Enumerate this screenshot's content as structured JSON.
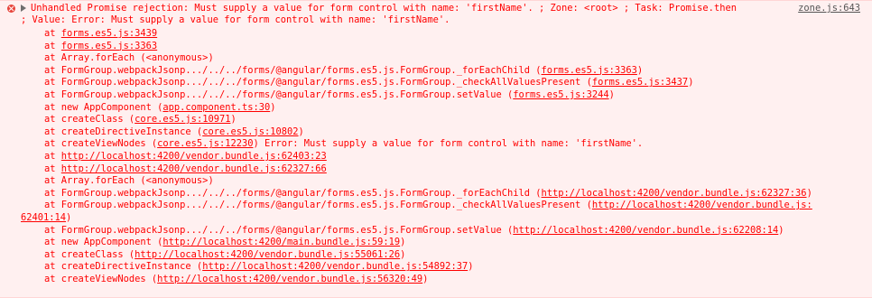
{
  "colors": {
    "background": "#fff0f0",
    "error_text": "#ff0000",
    "source_link": "#555555"
  },
  "icons": [
    "error-icon",
    "expand-triangle-icon"
  ],
  "message": {
    "line1": "Unhandled Promise rejection: Must supply a value for form control with name: 'firstName'. ; Zone: <root> ; Task: Promise.then",
    "line2": "; Value: Error: Must supply a value for form control with name: 'firstName'.",
    "source": "zone.js:643"
  },
  "stack": [
    {
      "pre": "    at ",
      "link": "forms.es5.js:3439",
      "post": ""
    },
    {
      "pre": "    at ",
      "link": "forms.es5.js:3363",
      "post": ""
    },
    {
      "pre": "    at Array.forEach (<anonymous>)",
      "link": "",
      "post": ""
    },
    {
      "pre": "    at FormGroup.webpackJsonp.../../../forms/@angular/forms.es5.js.FormGroup._forEachChild (",
      "link": "forms.es5.js:3363",
      "post": ")"
    },
    {
      "pre": "    at FormGroup.webpackJsonp.../../../forms/@angular/forms.es5.js.FormGroup._checkAllValuesPresent (",
      "link": "forms.es5.js:3437",
      "post": ")"
    },
    {
      "pre": "    at FormGroup.webpackJsonp.../../../forms/@angular/forms.es5.js.FormGroup.setValue (",
      "link": "forms.es5.js:3244",
      "post": ")"
    },
    {
      "pre": "    at new AppComponent (",
      "link": "app.component.ts:30",
      "post": ")"
    },
    {
      "pre": "    at createClass (",
      "link": "core.es5.js:10971",
      "post": ")"
    },
    {
      "pre": "    at createDirectiveInstance (",
      "link": "core.es5.js:10802",
      "post": ")"
    },
    {
      "pre": "    at createViewNodes (",
      "link": "core.es5.js:12230",
      "post": ") Error: Must supply a value for form control with name: 'firstName'."
    },
    {
      "pre": "    at ",
      "link": "http://localhost:4200/vendor.bundle.js:62403:23",
      "post": ""
    },
    {
      "pre": "    at ",
      "link": "http://localhost:4200/vendor.bundle.js:62327:66",
      "post": ""
    },
    {
      "pre": "    at Array.forEach (<anonymous>)",
      "link": "",
      "post": ""
    },
    {
      "pre": "    at FormGroup.webpackJsonp.../../../forms/@angular/forms.es5.js.FormGroup._forEachChild (",
      "link": "http://localhost:4200/vendor.bundle.js:62327:36",
      "post": ")"
    },
    {
      "pre": "    at FormGroup.webpackJsonp.../../../forms/@angular/forms.es5.js.FormGroup._checkAllValuesPresent (",
      "link": "http://localhost:4200/vendor.bundle.js:",
      "post": ""
    },
    {
      "pre": "",
      "link": "62401:14",
      "post": ")"
    },
    {
      "pre": "    at FormGroup.webpackJsonp.../../../forms/@angular/forms.es5.js.FormGroup.setValue (",
      "link": "http://localhost:4200/vendor.bundle.js:62208:14",
      "post": ")"
    },
    {
      "pre": "    at new AppComponent (",
      "link": "http://localhost:4200/main.bundle.js:59:19",
      "post": ")"
    },
    {
      "pre": "    at createClass (",
      "link": "http://localhost:4200/vendor.bundle.js:55061:26",
      "post": ")"
    },
    {
      "pre": "    at createDirectiveInstance (",
      "link": "http://localhost:4200/vendor.bundle.js:54892:37",
      "post": ")"
    },
    {
      "pre": "    at createViewNodes (",
      "link": "http://localhost:4200/vendor.bundle.js:56320:49",
      "post": ")"
    }
  ]
}
